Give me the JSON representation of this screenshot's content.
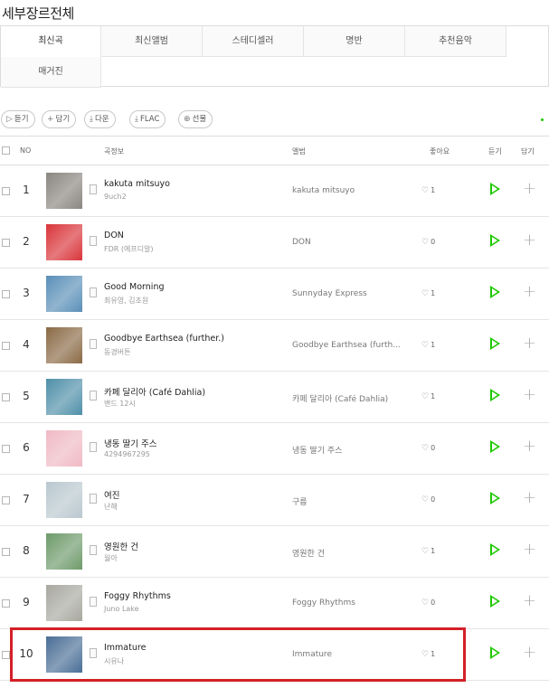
{
  "page": {
    "title": "세부장르전체"
  },
  "tabs": [
    {
      "label": "최신곡",
      "active": true
    },
    {
      "label": "최신앨범",
      "active": false
    },
    {
      "label": "스테디셀러",
      "active": false
    },
    {
      "label": "명반",
      "active": false
    },
    {
      "label": "추천음악",
      "active": false
    },
    {
      "label": "매거진",
      "active": false
    }
  ],
  "actions": {
    "listen": "듣기",
    "add": "담기",
    "download": "다운",
    "flac": "FLAC",
    "gift": "선물"
  },
  "header": {
    "no": "NO",
    "song": "곡정보",
    "album": "앨범",
    "likes": "좋아요",
    "play": "듣기",
    "add": "담기"
  },
  "rows": [
    {
      "rank": "1",
      "title": "kakuta mitsuyo",
      "artist": "9uch2",
      "album": "kakuta mitsuyo",
      "likes": "1",
      "thumb_color": "#8a8680"
    },
    {
      "rank": "2",
      "title": "DON",
      "artist": "FDR (에프디알)",
      "album": "DON",
      "likes": "0",
      "thumb_color": "#d9353a"
    },
    {
      "rank": "3",
      "title": "Good Morning",
      "artist": "최유영, 김초원",
      "album": "Sunnyday Express",
      "likes": "1",
      "thumb_color": "#5a8fb8"
    },
    {
      "rank": "4",
      "title": "Goodbye Earthsea (further.)",
      "artist": "동경버튼",
      "album": "Goodbye Earthsea (furth...",
      "likes": "1",
      "thumb_color": "#8a6a45"
    },
    {
      "rank": "5",
      "title": "카페 달리아 (Café Dahlia)",
      "artist": "밴드 12시",
      "album": "카페 달리아 (Café Dahlia)",
      "likes": "1",
      "thumb_color": "#4f8fa8"
    },
    {
      "rank": "6",
      "title": "냉동 딸기 주스",
      "artist": "4294967295",
      "album": "냉동 딸기 주스",
      "likes": "0",
      "thumb_color": "#f0b9c4"
    },
    {
      "rank": "7",
      "title": "여진",
      "artist": "난해",
      "album": "구름",
      "likes": "0",
      "thumb_color": "#b9c8cf"
    },
    {
      "rank": "8",
      "title": "영원한 건",
      "artist": "월아",
      "album": "영원한 건",
      "likes": "1",
      "thumb_color": "#6e9a6a"
    },
    {
      "rank": "9",
      "title": "Foggy Rhythms",
      "artist": "Juno Lake",
      "album": "Foggy Rhythms",
      "likes": "0",
      "thumb_color": "#a8a8a0"
    },
    {
      "rank": "10",
      "title": "Immature",
      "artist": "시유나",
      "album": "Immature",
      "likes": "1",
      "thumb_color": "#4a6e96"
    }
  ],
  "colors": {
    "accent": "#1ec800",
    "highlight": "#d32027"
  }
}
